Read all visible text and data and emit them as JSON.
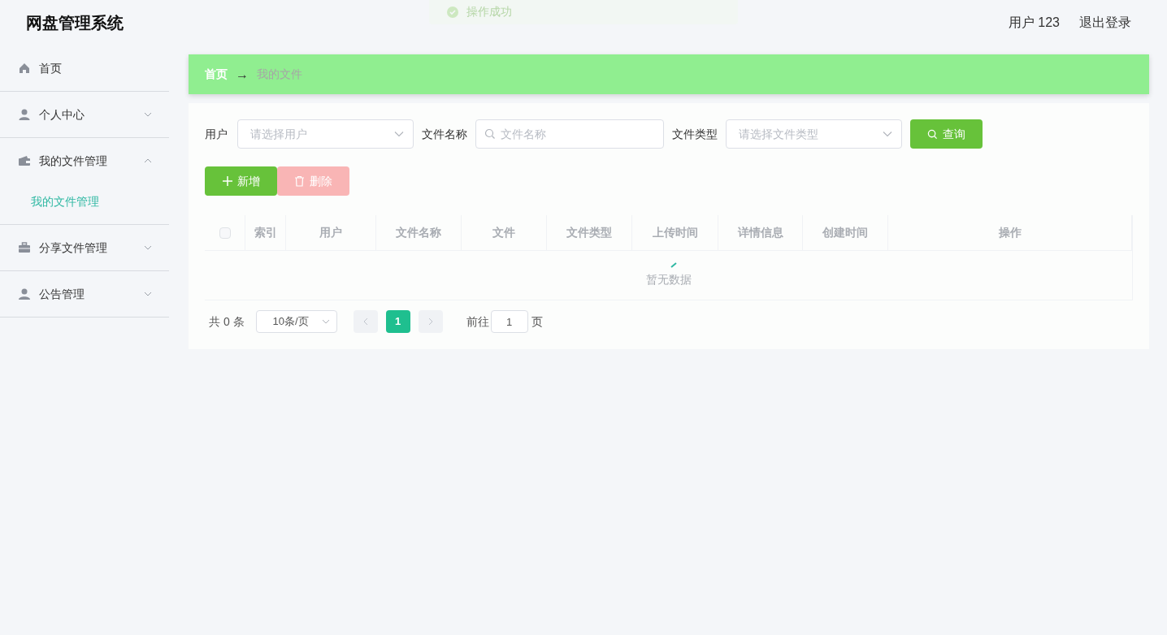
{
  "header": {
    "title": "网盘管理系统",
    "user": "用户 123",
    "logout": "退出登录"
  },
  "toast": {
    "message": "操作成功"
  },
  "sidebar": {
    "items": [
      {
        "label": "首页"
      },
      {
        "label": "个人中心",
        "expanded": false
      },
      {
        "label": "我的文件管理",
        "expanded": true,
        "children": [
          {
            "label": "我的文件管理",
            "selected": true
          }
        ]
      },
      {
        "label": "分享文件管理",
        "expanded": false
      },
      {
        "label": "公告管理",
        "expanded": false
      }
    ]
  },
  "breadcrumb": [
    {
      "label": "首页"
    },
    {
      "label": "我的文件"
    }
  ],
  "breadcrumb_separator": "→",
  "filters": [
    {
      "kind": "select",
      "label": "用户",
      "placeholder": "请选择用户"
    },
    {
      "kind": "search",
      "label": "文件名称",
      "placeholder": "文件名称"
    },
    {
      "kind": "select",
      "label": "文件类型",
      "placeholder": "请选择文件类型"
    }
  ],
  "query_button": "查询",
  "actions": [
    {
      "kind": "add",
      "label": "新增",
      "disabled": false
    },
    {
      "kind": "delete",
      "label": "删除",
      "disabled": true
    }
  ],
  "table": {
    "select_all_checked": false,
    "columns": [
      "索引",
      "用户",
      "文件名称",
      "文件",
      "文件类型",
      "上传时间",
      "详情信息",
      "创建时间",
      "操作"
    ],
    "empty_text": "暂无数据"
  },
  "pagination": {
    "total": "共 0 条",
    "page_size": "10条/页",
    "pages": [
      {
        "label": "1",
        "selected": true
      }
    ],
    "goto_label": "前往",
    "goto_value": "1",
    "goto_suffix": "页"
  }
}
